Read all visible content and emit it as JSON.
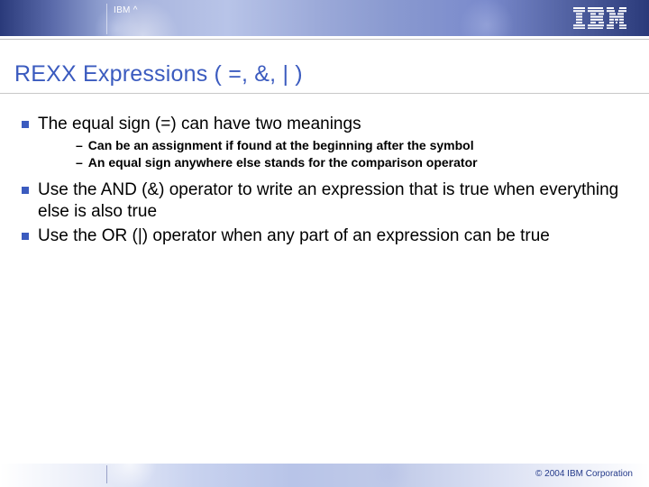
{
  "header": {
    "label": "IBM ^",
    "logo_name": "ibm-logo"
  },
  "title": "REXX Expressions ( =, &, | )",
  "bullets": [
    {
      "text": "The equal sign (=) can have two meanings",
      "sub": [
        "Can be an assignment if found at the beginning after the symbol",
        "An equal sign anywhere else stands for the comparison operator"
      ]
    },
    {
      "text": "Use the AND (&) operator to write an expression that is true when everything else is also true",
      "sub": []
    },
    {
      "text": "Use the OR (|) operator when any part of an expression can be true",
      "sub": []
    }
  ],
  "footer": {
    "copyright": "© 2004 IBM Corporation"
  }
}
